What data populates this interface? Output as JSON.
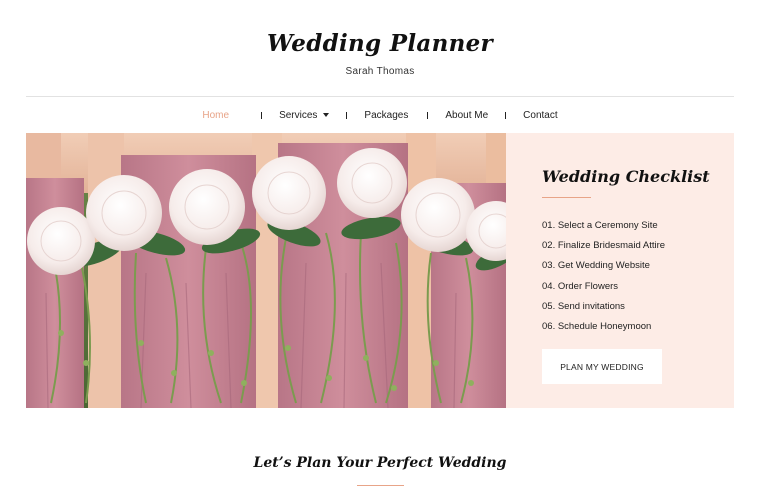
{
  "brand": {
    "title": "Wedding Planner",
    "subtitle": "Sarah Thomas"
  },
  "nav": {
    "items": [
      {
        "label": "Home",
        "active": true
      },
      {
        "label": "Services",
        "has_dropdown": true,
        "icon": "chevron-down-icon"
      },
      {
        "label": "Packages"
      },
      {
        "label": "About Me"
      },
      {
        "label": "Contact"
      }
    ]
  },
  "hero": {
    "image": "bridesmaids-holding-white-hydrangea-bouquets"
  },
  "checklist": {
    "title": "Wedding Checklist",
    "items": [
      "01. Select a Ceremony Site",
      "02. Finalize Bridesmaid Attire",
      "03. Get Wedding Website",
      "04. Order Flowers",
      "05. Send invitations",
      "06. Schedule Honeymoon"
    ],
    "button_label": "PLAN MY WEDDING"
  },
  "section": {
    "title": "Let’s Plan Your Perfect Wedding"
  },
  "colors": {
    "accent": "#e8a488",
    "panel_bg": "#fdece6",
    "text": "#222222",
    "divider": "#e2e2e2"
  }
}
